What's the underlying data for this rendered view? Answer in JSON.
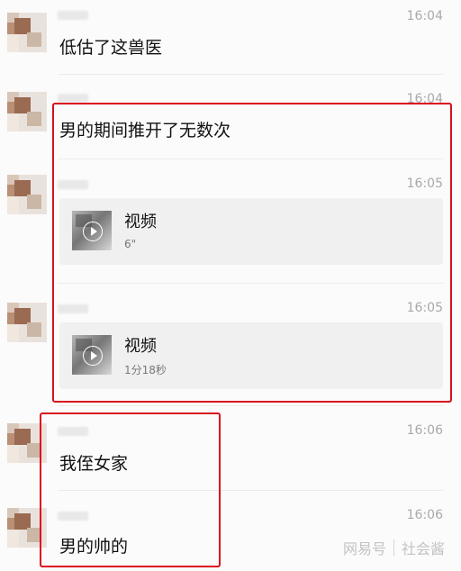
{
  "messages": [
    {
      "type": "text",
      "time": "16:04",
      "text": "低估了这兽医"
    },
    {
      "type": "text",
      "time": "16:04",
      "text": "男的期间推开了无数次"
    },
    {
      "type": "video",
      "time": "16:05",
      "title": "视频",
      "duration": "6\""
    },
    {
      "type": "video",
      "time": "16:05",
      "title": "视频",
      "duration": "1分18秒"
    },
    {
      "type": "text",
      "time": "16:06",
      "text": "我侄女家"
    },
    {
      "type": "text",
      "time": "16:06",
      "text": "男的帅的"
    }
  ],
  "watermark": {
    "left": "网易号",
    "right": "社会酱"
  },
  "colors": {
    "highlight_red": "#d90f1f",
    "card_bg": "#f0f0f0",
    "time_gray": "#a9a9a9"
  }
}
